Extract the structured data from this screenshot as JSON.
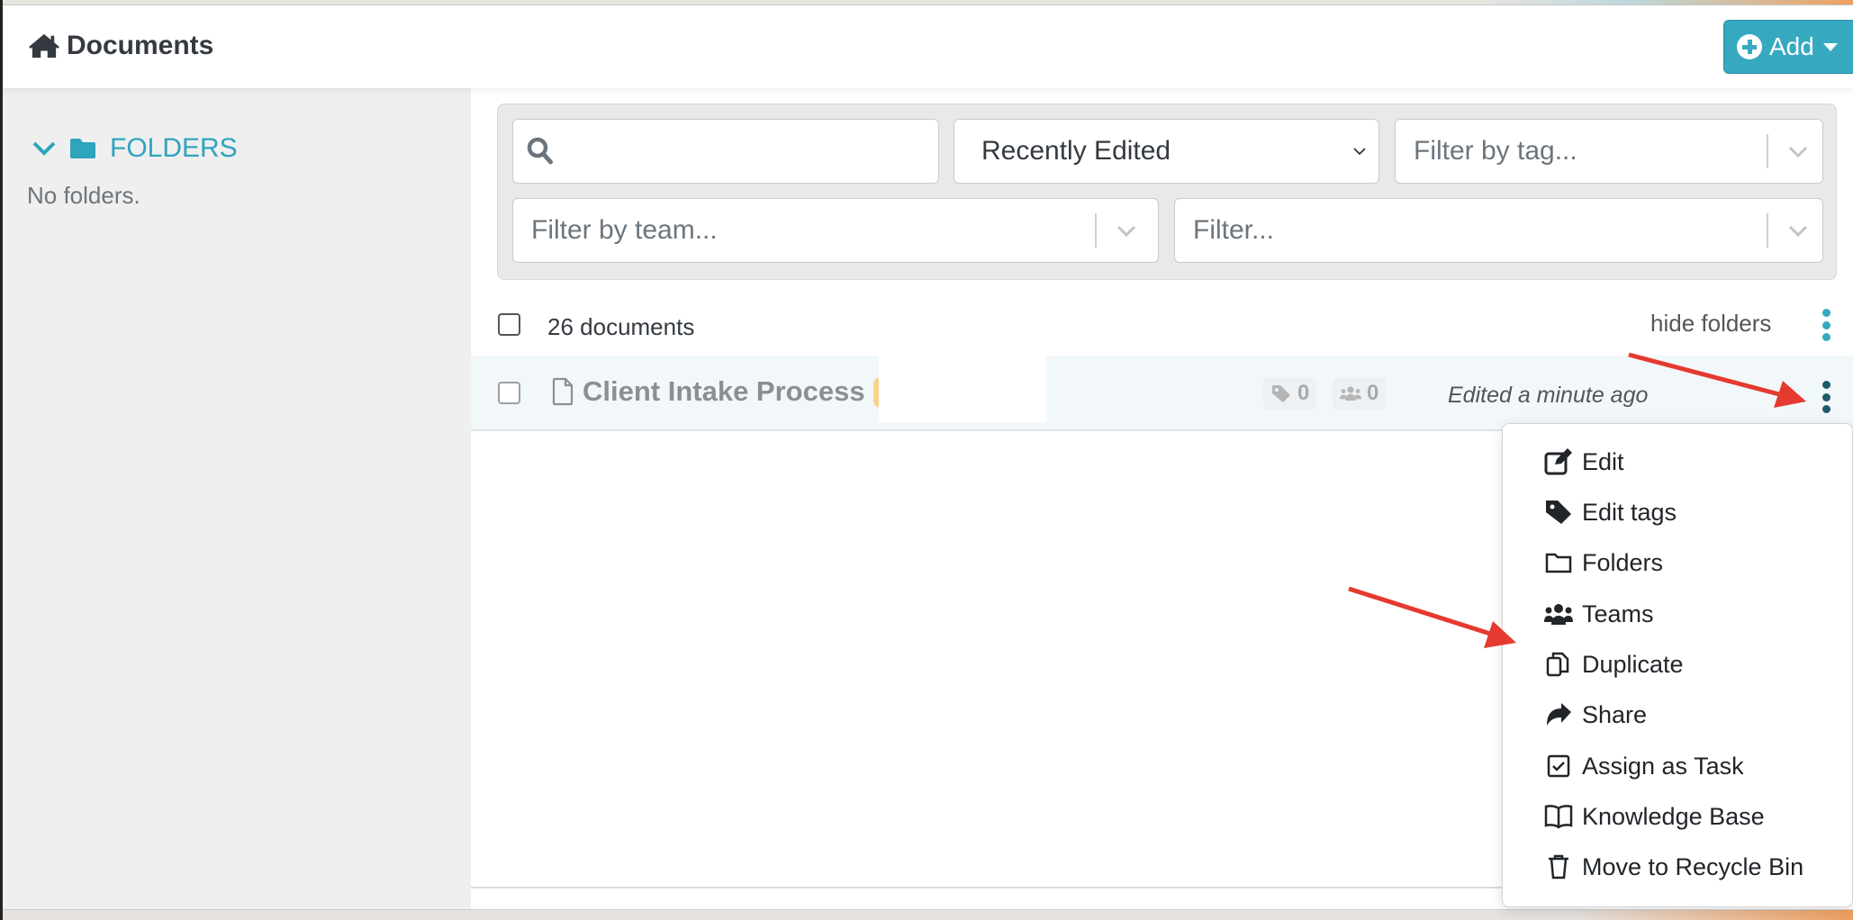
{
  "header": {
    "title": "Documents",
    "add_button": "Add"
  },
  "sidebar": {
    "folders_label": "FOLDERS",
    "empty_text": "No folders."
  },
  "filters": {
    "search": {
      "value": "",
      "placeholder": ""
    },
    "sort": {
      "selected": "Recently Edited"
    },
    "tag": {
      "placeholder": "Filter by tag..."
    },
    "team": {
      "placeholder": "Filter by team..."
    },
    "general": {
      "placeholder": "Filter..."
    }
  },
  "list": {
    "count_label": "26 documents",
    "hide_folders": "hide folders",
    "rows": [
      {
        "name": "Client Intake Process",
        "tag_count": "0",
        "team_count": "0",
        "edited": "Edited a minute ago"
      }
    ]
  },
  "menu": {
    "items": [
      {
        "label": "Edit",
        "icon": "edit-icon"
      },
      {
        "label": "Edit tags",
        "icon": "tag-icon"
      },
      {
        "label": "Folders",
        "icon": "folder-icon"
      },
      {
        "label": "Teams",
        "icon": "users-icon"
      },
      {
        "label": "Duplicate",
        "icon": "copy-icon"
      },
      {
        "label": "Share",
        "icon": "share-icon"
      },
      {
        "label": "Assign as Task",
        "icon": "checkbox-icon"
      },
      {
        "label": "Knowledge Base",
        "icon": "book-icon"
      },
      {
        "label": "Move to Recycle Bin",
        "icon": "trash-icon"
      }
    ]
  },
  "colors": {
    "accent": "#36a9c1",
    "annotation_arrow": "#e53a2f",
    "sidebar_bg": "#efefef",
    "row_highlight": "#f2f7fa"
  }
}
